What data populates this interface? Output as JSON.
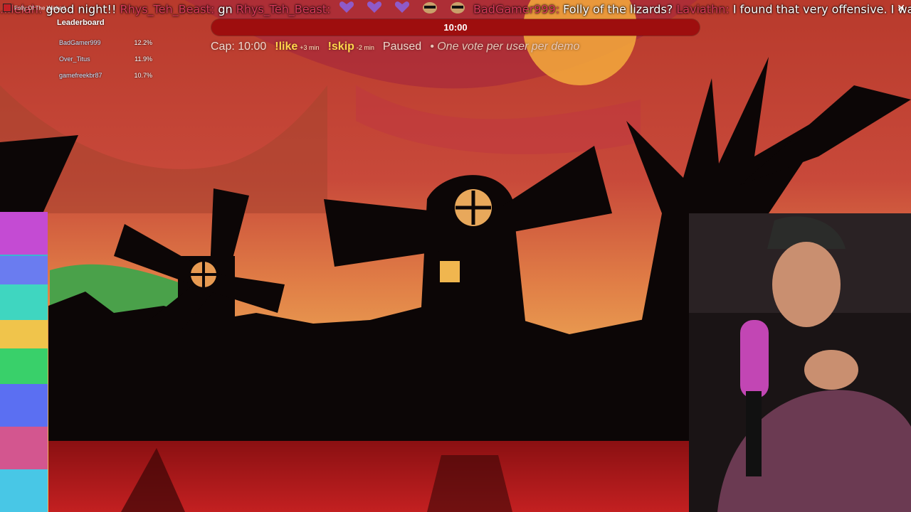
{
  "window": {
    "title": "Folly Of The Wicked"
  },
  "chat": {
    "prefix": "...lelah:",
    "first_msg": "good night!!",
    "messages": [
      {
        "user": "Rhys_Teh_Beast:",
        "text": "gn"
      },
      {
        "user": "Rhys_Teh_Beast:",
        "text": ""
      }
    ],
    "emotes": [
      "purple-heart",
      "purple-heart",
      "purple-heart",
      "sunglasses-cat",
      "sunglasses-cat"
    ],
    "after_emotes": [
      {
        "user": "BadGamer999:",
        "text": "Folly of the lizards?"
      },
      {
        "user": "Laviathn:",
        "text": "I found that very offensive. I was born without an ass."
      }
    ]
  },
  "leaderboard": {
    "title": "Leaderboard",
    "rows": [
      {
        "name": "BadGamer999",
        "pct": "12.2%"
      },
      {
        "name": "Over_Titus",
        "pct": "11.9%"
      },
      {
        "name": "gamefreekbr87",
        "pct": "10.7%"
      }
    ]
  },
  "timer": {
    "display": "10:00",
    "progress": 0.0
  },
  "votes": {
    "cap": "Cap: 10:00",
    "like_cmd": "!like",
    "like_delta": "+3 min",
    "skip_cmd": "!skip",
    "skip_delta": "-2 min",
    "status": "Paused",
    "note": "• One vote per user per demo"
  },
  "colors": {
    "progress_bg": "#9e0e0e",
    "cmd": "#ffd64b",
    "chat_user": "#d9395a"
  }
}
